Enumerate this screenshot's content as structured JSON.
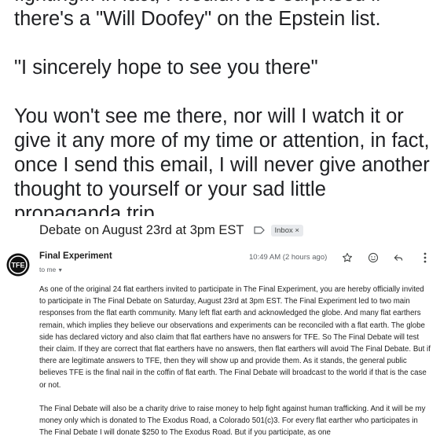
{
  "quoted_text": {
    "p1": "fighting... in fact, I wouldn't be surprised if there's a \"Will Doofey\" on the Epstein list.",
    "p2": "\"I sincerely hope to see you there\"",
    "p3": "You won't see me there, nor will I watch it or give it any more of my time or attention, in fact, once I send this email, I will never give another thought to yourself or your sad little propaganda trip."
  },
  "email": {
    "subject": "Debate on August 23rd at 3pm EST",
    "label_chip": "Inbox",
    "label_chip_close": "×",
    "sender_name": "Final Experiment",
    "avatar_text": "TFE",
    "recipient": "to me",
    "timestamp": "10:49 AM (2 hours ago)",
    "body_p1": "As one of the original 24 flat earthers invited to participate in The Final Experiment, you are hereby officially invited to participate in The Final Debate on Saturday, August 23rd at 3pm EST. The Final Experiment led to two main responses from the flat earth community. Many left flat earth and acknowledged the globe. And many flat earthers remain, which implies they believe our observations and experiments can be reconciled with a flat earth. The globe side has declared victory and also claim that flat earthers have no answers for TFE. So The Final Debate will test their claim. If they are correct that flat earthers have no answers, then flat earthers will avoid The Final Debate. But if there are legitimate answers to TFE, then they will show up and provide them. As it stands, the general public believes TFE is the final nail in the coffin of flat earth. The Final Debate will broadcast to the world if that is the case or not.",
    "body_p2": "The Final Debate will also be a charity drive to raise money to help fight against human trafficking. And it will be my money only which is donated to The Exodus Road, a Colorado 501(c)3. For every flat earther who participates in The Final Debate I will donate $250 to The Exodus Road. But if you participate, as one"
  },
  "icons": {
    "label": "label-arrow-icon",
    "star": "star-icon",
    "emoji": "emoji-icon",
    "reply": "reply-icon",
    "more": "more-vert-icon"
  }
}
